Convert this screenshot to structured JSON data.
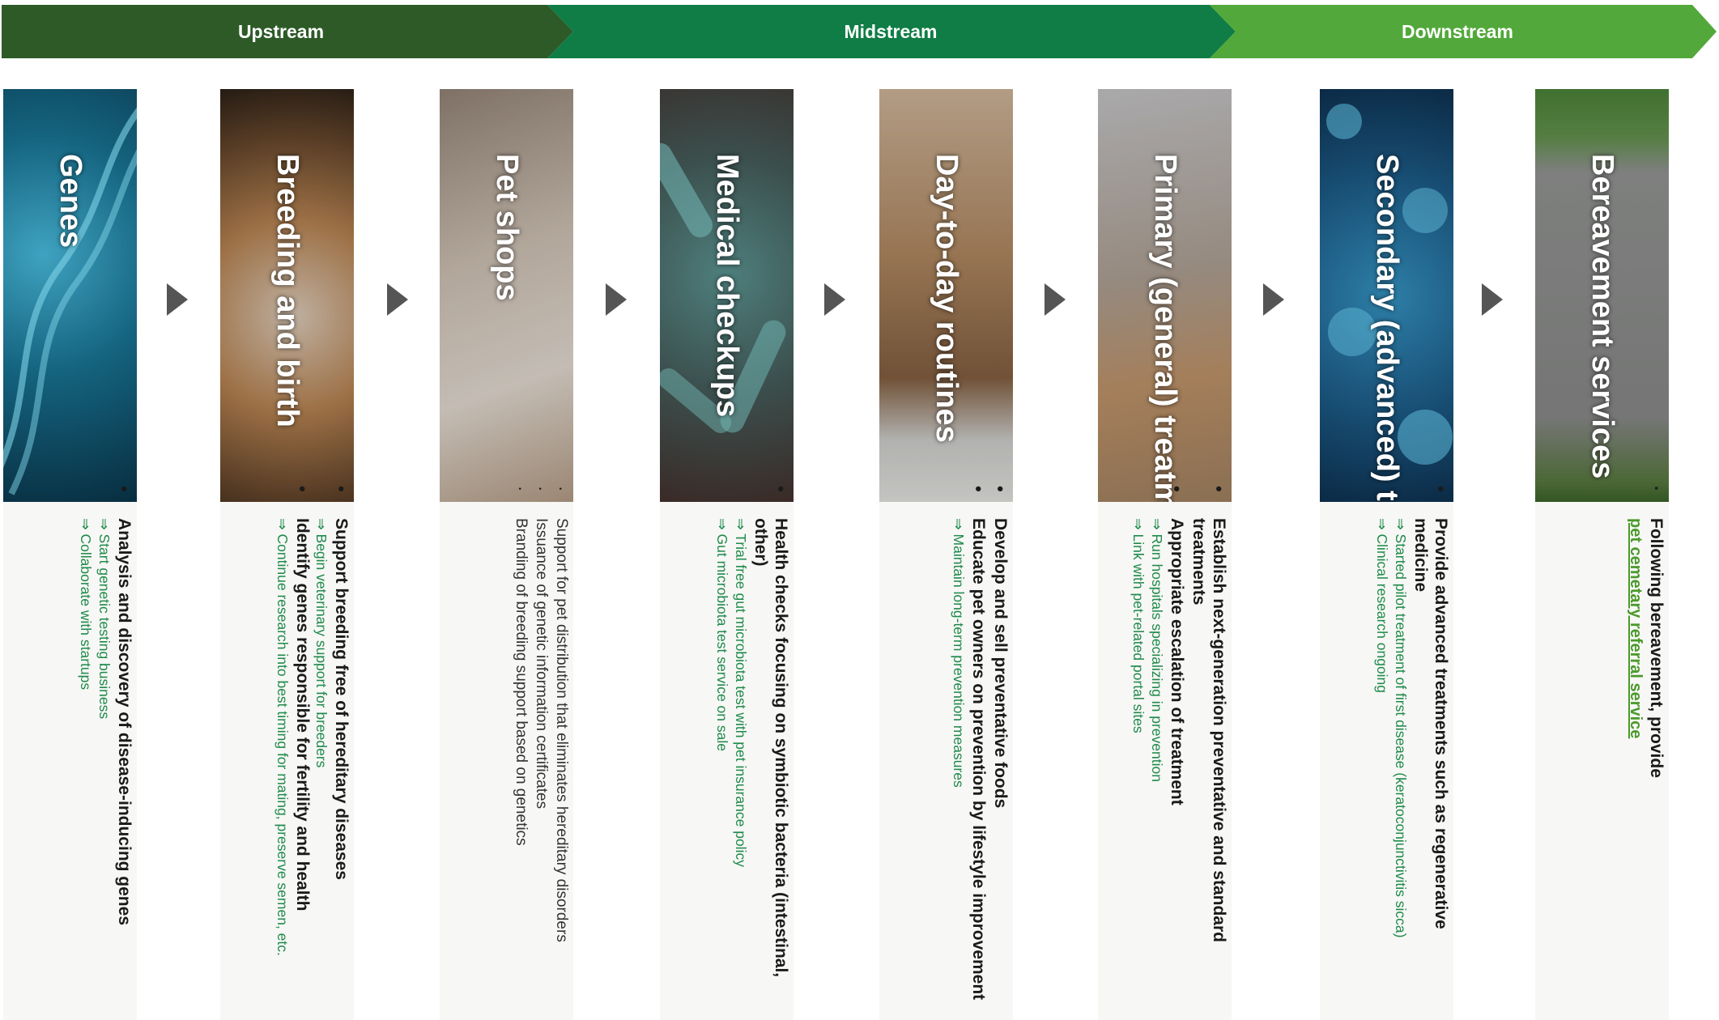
{
  "colors": {
    "upstream": "#2d5a27",
    "midstream": "#0f7d45",
    "downstream": "#52a83a",
    "sub_text": "#1e8a4a",
    "arrow": "#555555"
  },
  "stages": [
    "Upstream",
    "Midstream",
    "Downstream"
  ],
  "columns": [
    {
      "title": "Genes",
      "bullets": [
        {
          "text": "Analysis and discovery of disease-inducing genes",
          "subs": [
            "⇒ Start genetic testing business",
            "⇒ Collaborate with startups"
          ]
        }
      ]
    },
    {
      "title": "Breeding and birth",
      "bullets": [
        {
          "text": "Support breeding free of hereditary diseases",
          "subs": [
            "⇒ Begin veterinary support for breeders"
          ]
        },
        {
          "text": "Identify genes responsible for fertility and health",
          "subs": [
            "⇒ Continue research into best timing for mating, preserve semen, etc."
          ]
        }
      ]
    },
    {
      "title": "Pet shops",
      "light_bullets": [
        "Support for pet distribution that eliminates hereditary disorders",
        "Issuance of genetic information certificates",
        "Branding of breeding support based on genetics"
      ]
    },
    {
      "title": "Medical checkups",
      "bullets": [
        {
          "text": "Health checks focusing on symbiotic bacteria (intestinal, other)",
          "subs": [
            "⇒ Trial free gut microbiota test with pet insurance policy",
            "⇒ Gut microbiota test service on sale"
          ]
        }
      ]
    },
    {
      "title": "Day-to-day routines",
      "bullets": [
        {
          "text": "Develop and sell preventative foods",
          "subs": []
        },
        {
          "text": "Educate pet owners on prevention by lifestyle improvement",
          "subs": [
            "⇒ Maintain long-term prevention measures"
          ]
        }
      ]
    },
    {
      "title": "Primary (general) treatment",
      "bullets": [
        {
          "text": "Establish next-generation preventative and standard treatments",
          "subs": []
        },
        {
          "text": "Appropriate escalation of treatment",
          "subs": [
            "⇒ Run hospitals specializing in prevention",
            "⇒ Link with pet-related portal sites"
          ]
        }
      ]
    },
    {
      "title": "Secondary (advanced) treatment",
      "bullets": [
        {
          "text": "Provide advanced treatments such as regenerative medicine",
          "subs": [
            "⇒ Started pilot treatment of first disease (keratoconjunctivitis sicca)",
            "⇒ Clinical research ongoing"
          ]
        }
      ]
    },
    {
      "title": "Bereavement services",
      "bereavement": {
        "text": "Following bereavement, provide",
        "link": "pet cemetary referral service"
      }
    }
  ]
}
